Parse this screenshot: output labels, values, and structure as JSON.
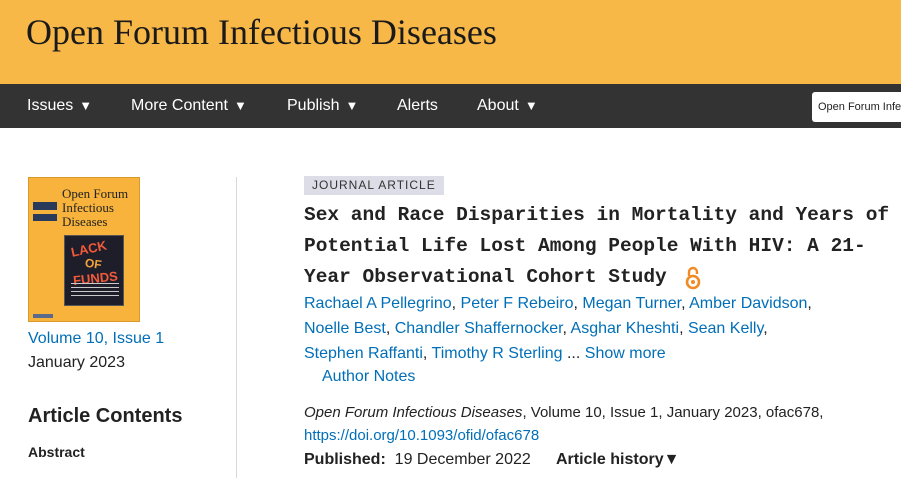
{
  "banner": {
    "title": "Open Forum Infectious Diseases"
  },
  "nav": {
    "items": [
      {
        "label": "Issues",
        "caret": "▼"
      },
      {
        "label": "More Content",
        "caret": "▼"
      },
      {
        "label": "Publish",
        "caret": "▼"
      },
      {
        "label": "Alerts",
        "caret": ""
      },
      {
        "label": "About",
        "caret": "▼"
      }
    ],
    "search_scope": "Open Forum Infectious Diseases"
  },
  "sidebar": {
    "cover": {
      "title_line1": "Open Forum",
      "title_line2": "Infectious",
      "title_line3": "Diseases",
      "art_text": "LACK OF FUNDS"
    },
    "volume_link": "Volume 10, Issue 1",
    "issue_date": "January 2023",
    "contents_heading": "Article Contents",
    "contents_items": [
      "Abstract"
    ]
  },
  "article": {
    "type": "JOURNAL ARTICLE",
    "title_lines": [
      "Sex and Race Disparities in Mortality and Years of",
      "Potential Life Lost Among People With HIV: A 21-",
      "Year Observational Cohort Study"
    ],
    "open_access_icon": "open-access-icon",
    "authors": [
      "Rachael A Pellegrino",
      "Peter F Rebeiro",
      "Megan Turner",
      "Amber Davidson",
      "Noelle Best",
      "Stephen Raffanti",
      "Timothy R Sterling",
      "Asghar Kheshti",
      "Sean Kelly",
      "Chandler Shaffernocker"
    ],
    "show_more": "Show more",
    "ellipsis": "...",
    "author_notes": "Author Notes",
    "journal_name": "Open Forum Infectious Diseases",
    "citation_rest": ", Volume 10, Issue 1, January 2023, ofac678,",
    "doi": "https://doi.org/10.1093/ofid/ofac678",
    "published_label": "Published:",
    "published_date": "19 December 2022",
    "history_label": "Article history",
    "history_caret": "▼"
  },
  "colors": {
    "banner": "#f8b848",
    "nav": "#333333",
    "link": "#006fb7",
    "open_access": "#f08a24"
  }
}
